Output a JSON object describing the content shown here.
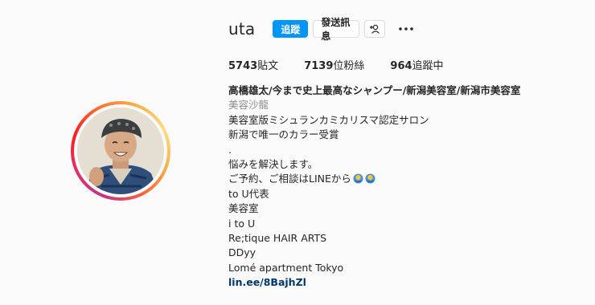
{
  "profile": {
    "username": "uta",
    "follow_label": "追蹤",
    "message_label": "發送訊息",
    "suggest_icon": "add-person-icon",
    "more_icon": "more-horizontal-icon"
  },
  "stats": {
    "posts_count": "5743",
    "posts_label": "貼文",
    "followers_count": "7139",
    "followers_label": "位粉絲",
    "following_count": "964",
    "following_label": "追蹤中"
  },
  "bio": {
    "name": "高橋雄太/今まで史上最高なシャンプー/新潟美容室/新潟市美容室",
    "category": "美容沙龍",
    "lines": [
      "美容室版ミシュランカミカリスマ認定サロン",
      "新潟で唯一のカラー受賞",
      ".",
      "悩みを解決します。",
      "ご予約、ご相談はLINEから",
      "to U代表",
      "美容室",
      "i to U",
      "Re;tique HAIR ARTS",
      "DDyy",
      "Lomé apartment Tokyo"
    ],
    "link": "lin.ee/8BajhZl"
  },
  "colors": {
    "accent": "#0095f6",
    "link": "#00376b",
    "muted": "#8e8e8e",
    "ring": [
      "#c13584",
      "#e1306c",
      "#f77737",
      "#fcaf45"
    ]
  }
}
